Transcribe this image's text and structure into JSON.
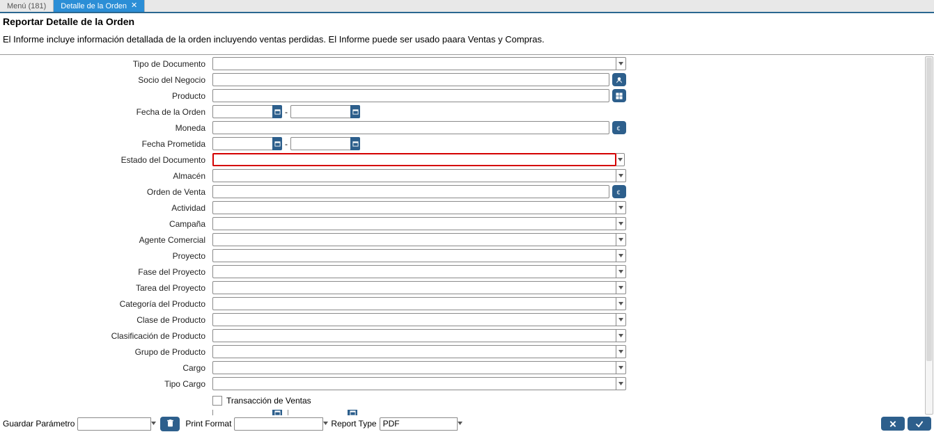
{
  "tabs": {
    "menu": "Menú (181)",
    "active": "Detalle de la Orden"
  },
  "title": "Reportar Detalle de la Orden",
  "description": "El Informe incluye información detallada de la orden incluyendo ventas perdidas. El Informe puede ser usado paara Ventas y Compras.",
  "labels": {
    "tipo_documento": "Tipo de Documento",
    "socio_negocio": "Socio del Negocio",
    "producto": "Producto",
    "fecha_orden": "Fecha de la Orden",
    "moneda": "Moneda",
    "fecha_prometida": "Fecha Prometida",
    "estado_documento": "Estado del Documento",
    "almacen": "Almacén",
    "orden_venta": "Orden de Venta",
    "actividad": "Actividad",
    "campana": "Campaña",
    "agente_comercial": "Agente Comercial",
    "proyecto": "Proyecto",
    "fase_proyecto": "Fase del Proyecto",
    "tarea_proyecto": "Tarea del Proyecto",
    "categoria_producto": "Categoría del Producto",
    "clase_producto": "Clase de Producto",
    "clasificacion_producto": "Clasificación de Producto",
    "grupo_producto": "Grupo de Producto",
    "cargo": "Cargo",
    "tipo_cargo": "Tipo Cargo",
    "transaccion_ventas": "Transacción de Ventas"
  },
  "footer": {
    "guardar_parametro": "Guardar Parámetro",
    "print_format": "Print Format",
    "report_type": "Report Type",
    "report_type_value": "PDF"
  },
  "date_separator": "-"
}
